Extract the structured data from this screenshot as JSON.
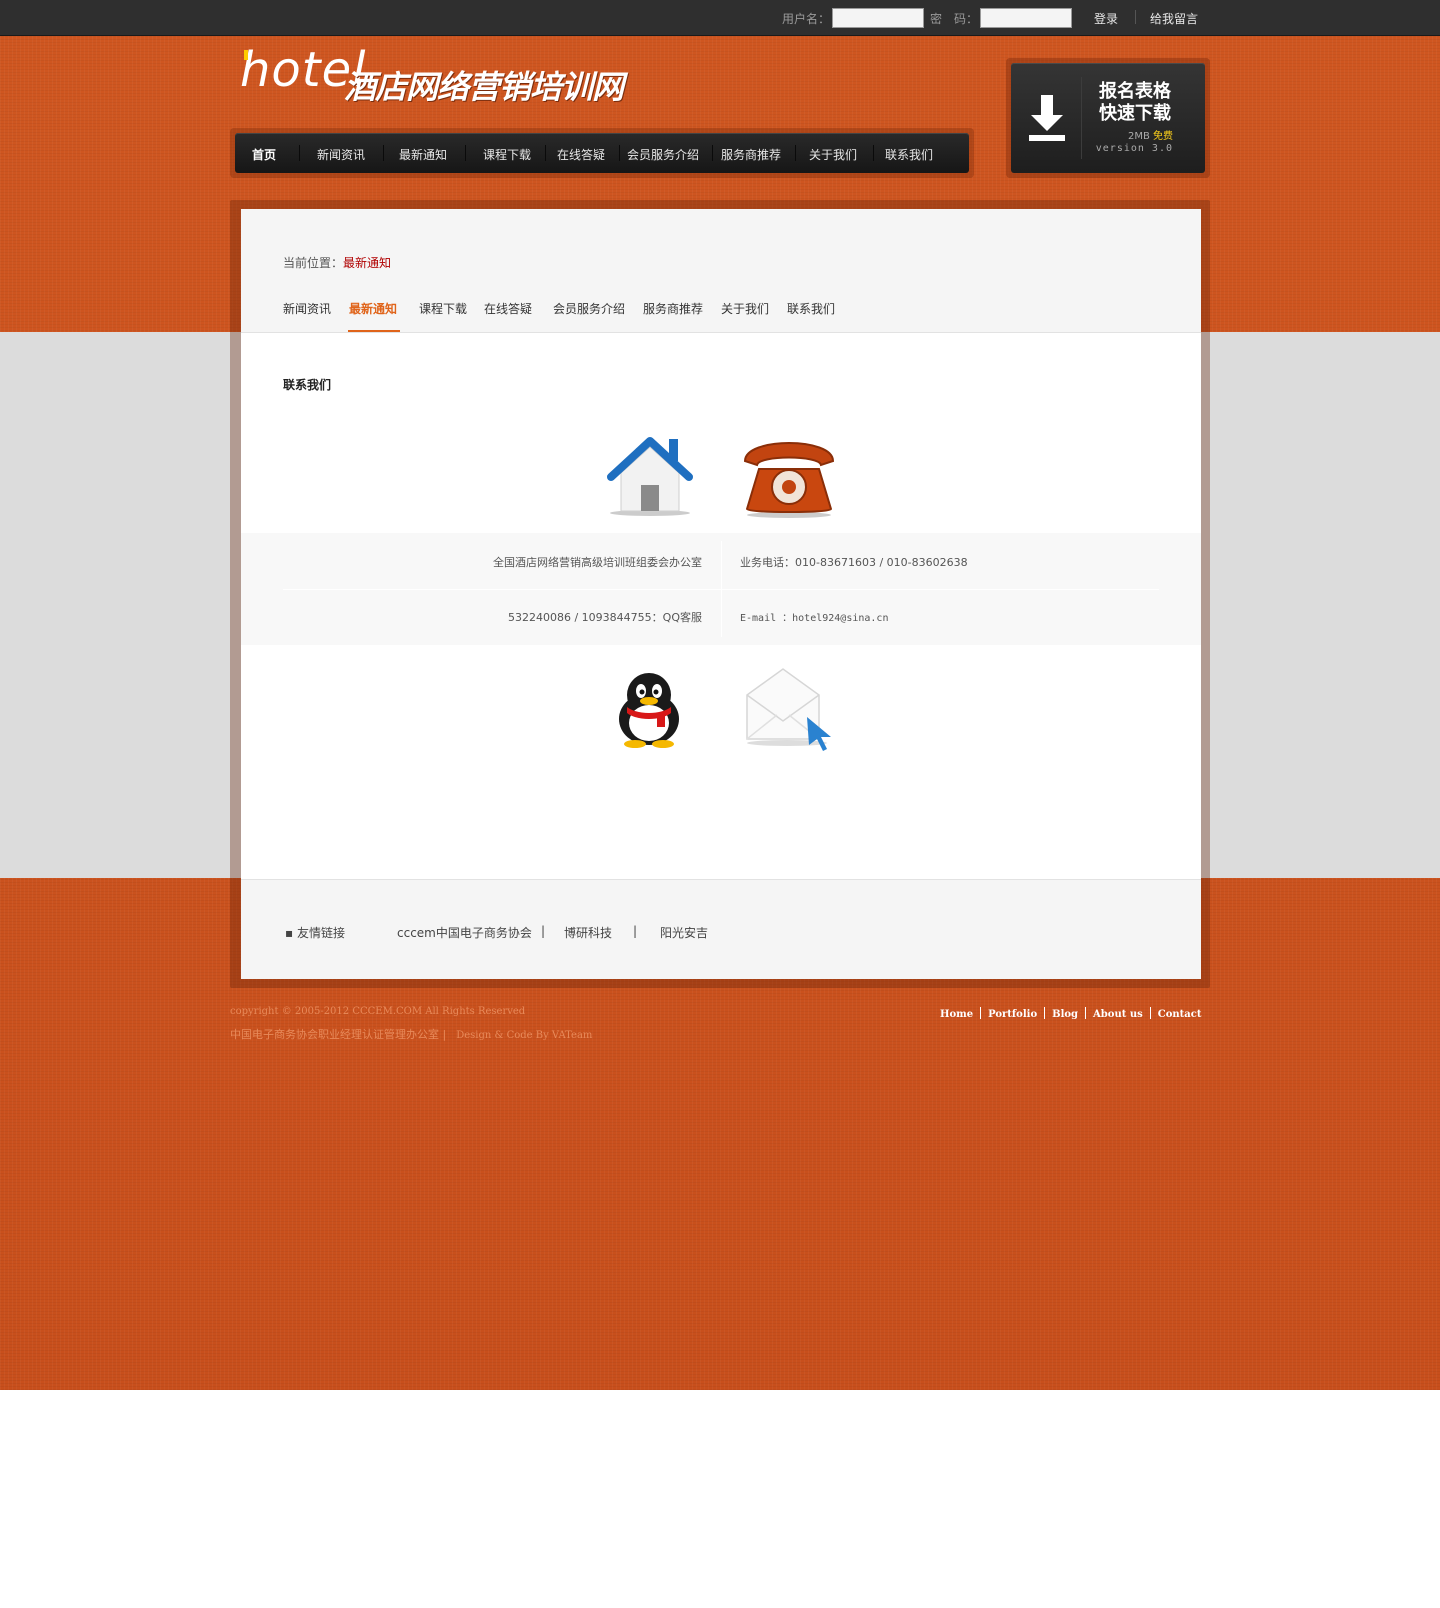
{
  "topbar": {
    "username_label": "用户名：",
    "password_label": "密　码：",
    "login": "登录",
    "message": "给我留言"
  },
  "logo": {
    "en": "hotel",
    "cn": "酒店网络营销培训网"
  },
  "nav": {
    "items": [
      "首页",
      "新闻资讯",
      "最新通知",
      "课程下载",
      "在线答疑",
      "会员服务介绍",
      "服务商推荐",
      "关于我们",
      "联系我们"
    ]
  },
  "download": {
    "line1": "报名表格",
    "line2": "快速下载",
    "size": "2MB",
    "free": "免费",
    "version": "version 3.0"
  },
  "breadcrumb": {
    "prefix": "当前位置：",
    "current": "最新通知"
  },
  "subnav": {
    "items": [
      "新闻资讯",
      "最新通知",
      "课程下载",
      "在线答疑",
      "会员服务介绍",
      "服务商推荐",
      "关于我们",
      "联系我们"
    ],
    "active": "最新通知"
  },
  "section_title": "联系我们",
  "contact": {
    "office": "全国酒店网络营销高级培训班组委会办公室",
    "phone": "业务电话：010-83671603 / 010-83602638",
    "qq": "532240086 / 1093844755：QQ客服",
    "email": "E-mail ：hotel924@sina.cn"
  },
  "links": {
    "label": "友情链接",
    "items": [
      "cccem中国电子商务协会",
      "博研科技",
      "阳光安吉"
    ]
  },
  "footer": {
    "copyright": "copyright © 2005-2012 CCCEM.COM All Rights Reserved",
    "org": "中国电子商务协会职业经理认证管理办公室 |",
    "design": "Design & Code By VATeam",
    "nav": [
      "Home",
      "Portfolio",
      "Blog",
      "About us",
      "Contact"
    ]
  }
}
